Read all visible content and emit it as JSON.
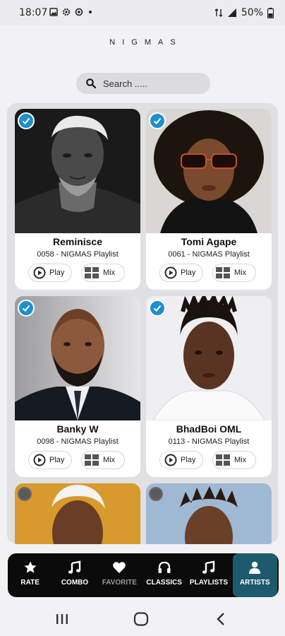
{
  "status_bar": {
    "time": "18:07",
    "battery": "50%"
  },
  "app": {
    "title": "NIGMAS"
  },
  "search": {
    "placeholder": "Search ....."
  },
  "artists": [
    {
      "name": "Reminisce",
      "subtitle": "0058 - NIGMAS Playlist",
      "selected": true
    },
    {
      "name": "Tomi Agape",
      "subtitle": "0061 - NIGMAS Playlist",
      "selected": true
    },
    {
      "name": "Banky W",
      "subtitle": "0098 - NIGMAS Playlist",
      "selected": true
    },
    {
      "name": "BhadBoi OML",
      "subtitle": "0113 - NIGMAS Playlist",
      "selected": true
    },
    {
      "name": "",
      "subtitle": "",
      "selected": false
    },
    {
      "name": "",
      "subtitle": "",
      "selected": false
    }
  ],
  "buttons": {
    "play": "Play",
    "mix": "Mix"
  },
  "nav": {
    "items": [
      {
        "label": "RATE",
        "icon": "star-icon"
      },
      {
        "label": "COMBO",
        "icon": "music-note-icon"
      },
      {
        "label": "FAVORITE",
        "icon": "heart-icon"
      },
      {
        "label": "CLASSICS",
        "icon": "headphones-icon"
      },
      {
        "label": "PLAYLISTS",
        "icon": "music-note-icon"
      },
      {
        "label": "ARTISTS",
        "icon": "person-icon"
      }
    ],
    "active": "ARTISTS"
  },
  "colors": {
    "accent": "#1e5a6e",
    "check": "#1f8fce",
    "nav_bg": "#0b0b0b"
  }
}
